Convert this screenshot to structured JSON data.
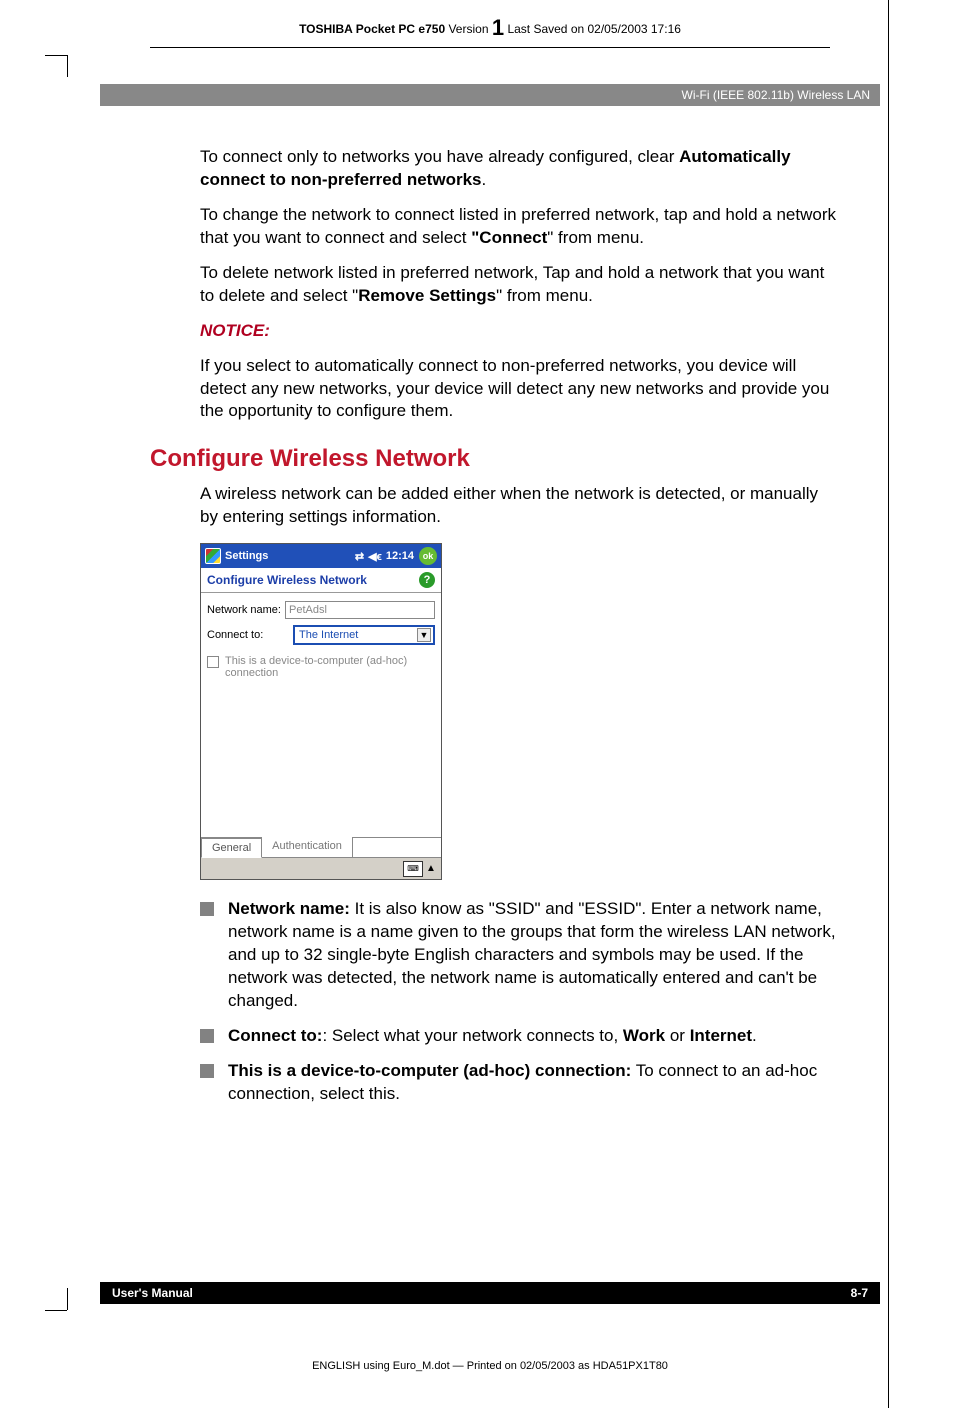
{
  "header": {
    "product": "TOSHIBA Pocket PC e750",
    "version_label": "Version",
    "version_num": "1",
    "saved": "Last Saved on 02/05/2003 17:16"
  },
  "greybar": "Wi-Fi (IEEE 802.11b) Wireless LAN",
  "p1a": "To connect only to networks you have already configured, clear ",
  "p1b": "Automatically connect to non-preferred networks",
  "p1c": ".",
  "p2a": "To change the network to connect listed in preferred network, tap and hold a network that you want to connect and select ",
  "p2b": "\"Connect",
  "p2c": "\" from menu.",
  "p3a": "To delete network listed in preferred network, Tap and hold a network that you want to delete and select \"",
  "p3b": "Remove Settings",
  "p3c": "\" from menu.",
  "notice": "NOTICE:",
  "p4": "If you select to automatically connect to non-preferred networks, you device will detect any new networks, your device will detect any new networks and provide you the opportunity to configure them.",
  "h1": "Configure Wireless Network",
  "p5": "A wireless network can be added either when the network is detected, or manually by entering settings information.",
  "ppc": {
    "title": "Settings",
    "time": "12:14",
    "ok": "ok",
    "subtitle": "Configure Wireless Network",
    "help": "?",
    "label_net": "Network name:",
    "value_net": "PetAdsl",
    "label_conn": "Connect to:",
    "value_conn": "The Internet",
    "chk": "This is a device-to-computer (ad-hoc) connection",
    "tab1": "General",
    "tab2": "Authentication"
  },
  "bullets": {
    "b1a": "Network name:",
    "b1b": " It is also know as \"SSID\" and \"ESSID\". Enter a network name, network name is a name given to the groups that form the wireless LAN network, and up to 32 single-byte English characters and symbols may be used. If the network was detected, the network name is automatically entered and can't be changed.",
    "b2a": "Connect to:",
    "b2b": ": Select what your network connects to, ",
    "b2c": "Work",
    "b2d": " or ",
    "b2e": "Internet",
    "b2f": ".",
    "b3a": "This is a device-to-computer (ad-hoc) connection:",
    "b3b": " To connect to an ad-hoc connection, select this."
  },
  "footer": {
    "left": "User's Manual",
    "right": "8-7"
  },
  "printline": "ENGLISH using Euro_M.dot — Printed on 02/05/2003 as HDA51PX1T80"
}
